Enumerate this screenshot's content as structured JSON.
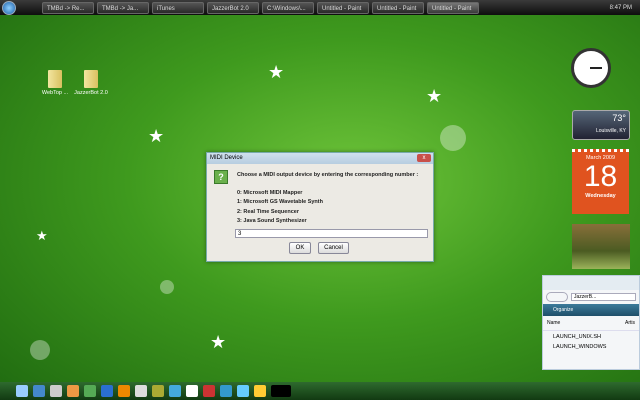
{
  "taskbar": {
    "items": [
      "TMBd -> Re...",
      "TMBd -> Ja...",
      "iTunes",
      "JazzerBot 2.0",
      "C:\\Windows\\...",
      "Untitled - Paint",
      "Untitled - Paint",
      "Untitled - Paint"
    ],
    "time": "8:47 PM"
  },
  "desktop": {
    "icons": [
      "WebTop ...",
      "JazzerBot 2.0"
    ]
  },
  "dialog": {
    "title": "MIDI Device",
    "prompt": "Choose a MIDI output device by entering the corresponding number :",
    "options": [
      "0: Microsoft MIDI Mapper",
      "1: Microsoft GS Wavetable Synth",
      "2: Real Time Sequencer",
      "3: Java Sound Synthesizer"
    ],
    "input_value": "3",
    "ok": "OK",
    "cancel": "Cancel",
    "close": "x"
  },
  "gadgets": {
    "weather_temp": "73°",
    "weather_city": "Louisville, KY",
    "cal_month": "March 2009",
    "cal_day": "18",
    "cal_weekday": "Wednesday"
  },
  "explorer": {
    "path": "JazzerB...",
    "organize": "Organize",
    "col_name": "Name",
    "col_artist": "Artis",
    "files": [
      "LAUNCH_UNIX.SH",
      "LAUNCH_WINDOWS"
    ]
  }
}
